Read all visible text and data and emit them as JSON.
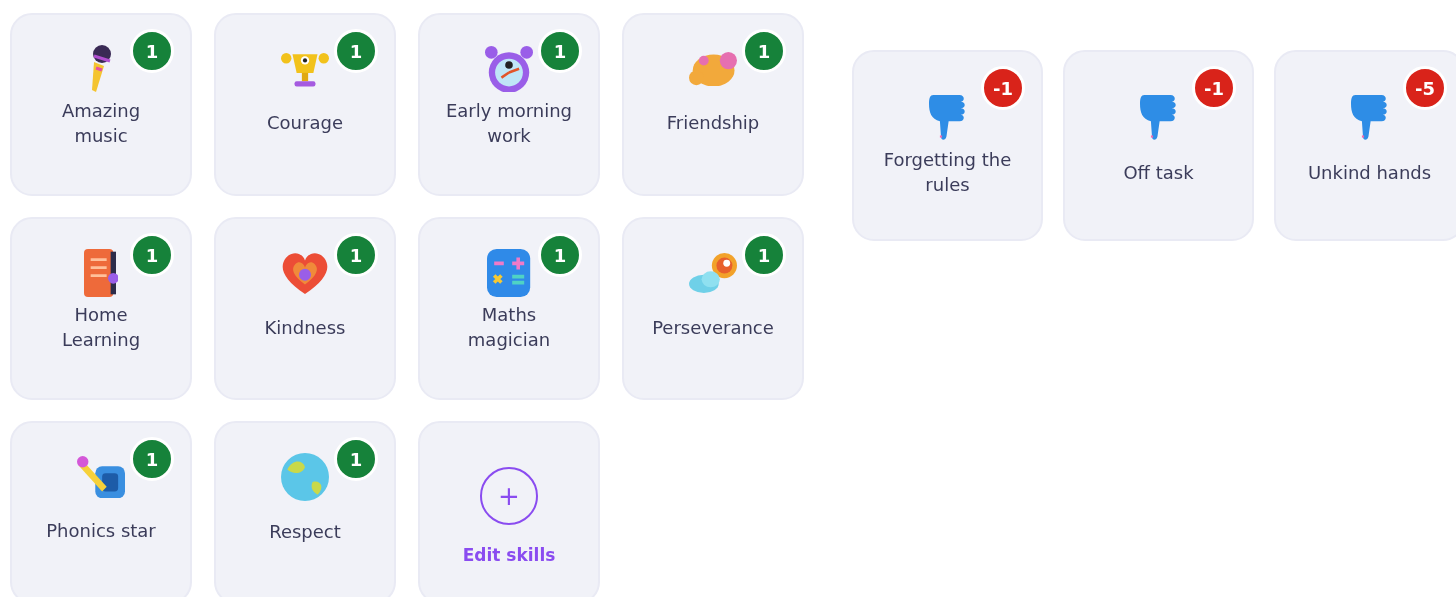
{
  "skills": [
    {
      "label": "Amazing\nmusic",
      "points": "1"
    },
    {
      "label": "Courage",
      "points": "1"
    },
    {
      "label": "Early morning\nwork",
      "points": "1"
    },
    {
      "label": "Friendship",
      "points": "1"
    },
    {
      "label": "Home\nLearning",
      "points": "1"
    },
    {
      "label": "Kindness",
      "points": "1"
    },
    {
      "label": "Maths\nmagician",
      "points": "1"
    },
    {
      "label": "Perseverance",
      "points": "1"
    },
    {
      "label": "Phonics star",
      "points": "1"
    },
    {
      "label": "Respect",
      "points": "1"
    }
  ],
  "edit_button": {
    "label": "Edit skills",
    "symbol": "+"
  },
  "needs_work": [
    {
      "label": "Forgetting the\nrules",
      "points": "-1"
    },
    {
      "label": "Off task",
      "points": "-1"
    },
    {
      "label": "Unkind hands",
      "points": "-5"
    }
  ]
}
